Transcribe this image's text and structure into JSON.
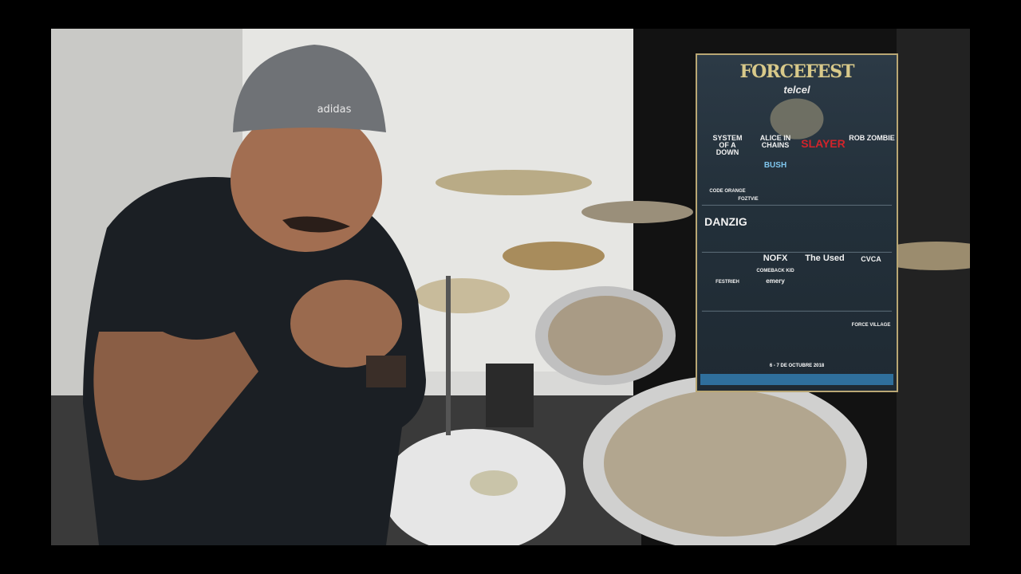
{
  "poster": {
    "title": "FORCEFEST",
    "subtitle": "telcel",
    "day1_headliners": [
      "SYSTEM OF A DOWN",
      "ALICE IN CHAINS",
      "SLAYER",
      "ROB ZOMBIE"
    ],
    "day1_others": [
      "BUSH",
      "CODE ORANGE",
      "FOZTVIE"
    ],
    "day2_headliners": [
      "DANZIG",
      "NOFX",
      "The Used",
      "CVCA"
    ],
    "day2_others": [
      "COMEBACK KID",
      "emery",
      "FESTRIEH"
    ],
    "day3_headliners": [
      "FORCE VILLAGE"
    ],
    "date": "6 - 7 DE OCTUBRE 2018"
  },
  "colors": {
    "poster_bg": "#23303a",
    "poster_border": "#b9a774",
    "accent_blue": "#7fc6ee",
    "accent_red": "#d2232a"
  }
}
